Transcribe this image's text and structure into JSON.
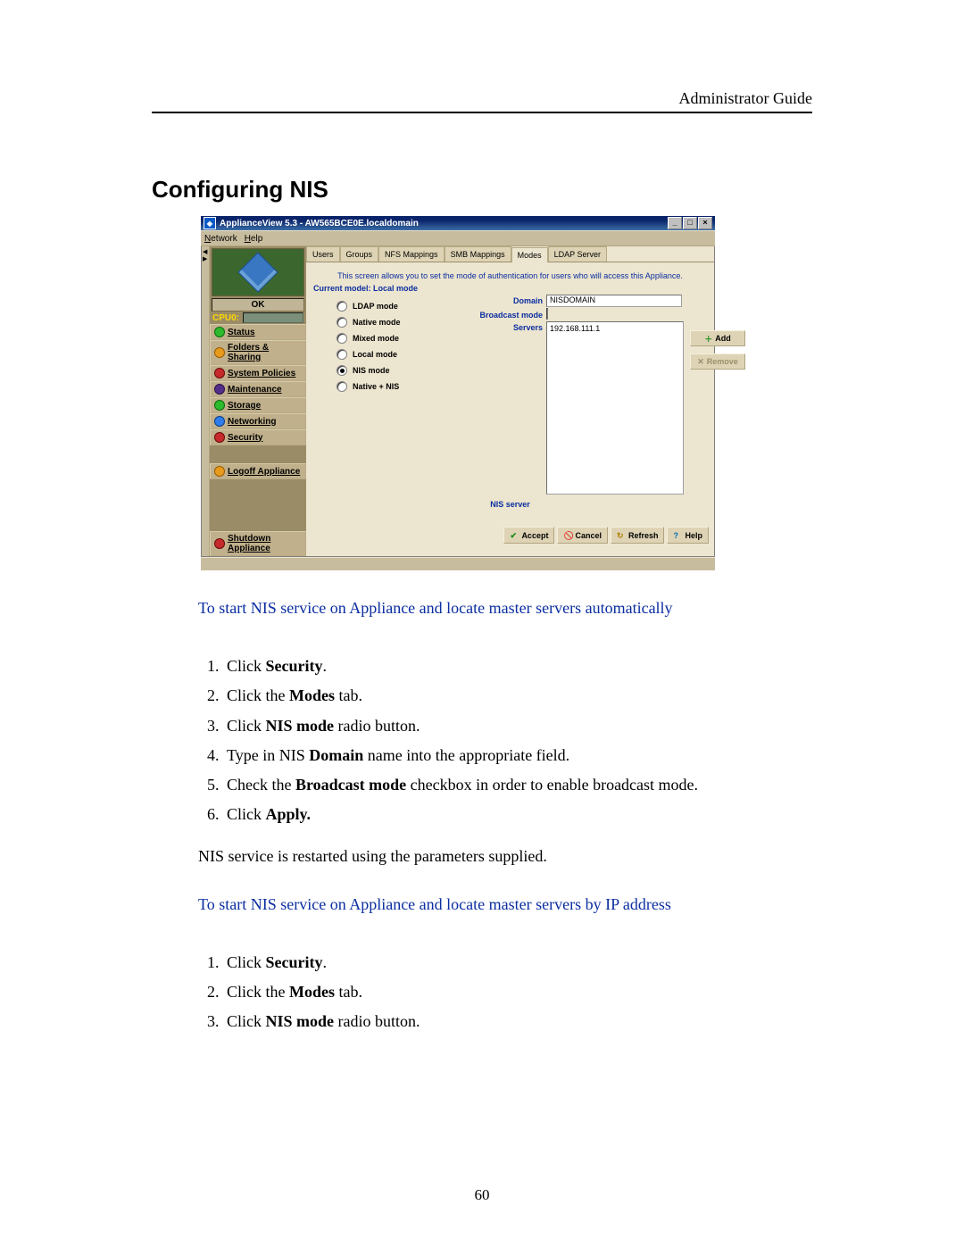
{
  "header_right": "Administrator Guide",
  "section_title": "Configuring NIS",
  "window": {
    "title": "ApplianceView 5.3 - AW565BCE0E.localdomain",
    "controls": {
      "min": "_",
      "max": "□",
      "close": "×"
    }
  },
  "menubar": {
    "network": "Network",
    "help": "Help"
  },
  "sidebar": {
    "ok_label": "OK",
    "cpu_label": "CPU0:",
    "items": [
      {
        "label": "Status",
        "color": "green"
      },
      {
        "label": "Folders & Sharing",
        "color": "orange"
      },
      {
        "label": "System Policies",
        "color": "red"
      },
      {
        "label": "Maintenance",
        "color": "purple"
      },
      {
        "label": "Storage",
        "color": "green"
      },
      {
        "label": "Networking",
        "color": "blue"
      },
      {
        "label": "Security",
        "color": "red"
      }
    ],
    "logoff": "Logoff Appliance",
    "shutdown": "Shutdown Appliance"
  },
  "tabs": {
    "users": "Users",
    "groups": "Groups",
    "nfs_mappings": "NFS Mappings",
    "smb_mappings": "SMB Mappings",
    "modes": "Modes",
    "ldap_server": "LDAP Server"
  },
  "modes_panel": {
    "description": "This screen allows you to set the mode of authentication for users who will access this Appliance.",
    "current_model_label": "Current model: Local mode",
    "radios": {
      "ldap": "LDAP mode",
      "native": "Native mode",
      "mixed": "Mixed mode",
      "local": "Local mode",
      "nis": "NIS mode",
      "native_nis": "Native + NIS"
    },
    "selected_radio": "nis",
    "domain_label": "Domain",
    "domain_value": "NISDOMAIN",
    "broadcast_label": "Broadcast mode",
    "servers_label": "Servers",
    "server_value": "192.168.111.1",
    "nis_server_label": "NIS server",
    "add_btn": "Add",
    "remove_btn": "Remove"
  },
  "action_buttons": {
    "accept": "Accept",
    "cancel": "Cancel",
    "refresh": "Refresh",
    "help": "Help"
  },
  "blue_heading_1": "To start NIS service on Appliance and locate master servers automatically",
  "steps1": {
    "s1_a": "Click ",
    "s1_b": "Security",
    "s1_c": ".",
    "s2_a": "Click the ",
    "s2_b": "Modes",
    "s2_c": " tab.",
    "s3_a": "Click ",
    "s3_b": "NIS mode",
    "s3_c": " radio button.",
    "s4_a": "Type in NIS ",
    "s4_b": "Domain",
    "s4_c": " name into the appropriate field.",
    "s5_a": "Check the ",
    "s5_b": "Broadcast mode",
    "s5_c": " checkbox in order to enable broadcast mode.",
    "s6_a": "Click ",
    "s6_b": "Apply.",
    "s6_c": ""
  },
  "after_steps1": "NIS service is restarted using the parameters supplied.",
  "blue_heading_2": "To start NIS service on Appliance and locate master servers by IP address",
  "steps2": {
    "s1_a": "Click ",
    "s1_b": "Security",
    "s1_c": ".",
    "s2_a": "Click the ",
    "s2_b": "Modes",
    "s2_c": " tab.",
    "s3_a": "Click ",
    "s3_b": "NIS mode",
    "s3_c": " radio button."
  },
  "page_number": "60"
}
